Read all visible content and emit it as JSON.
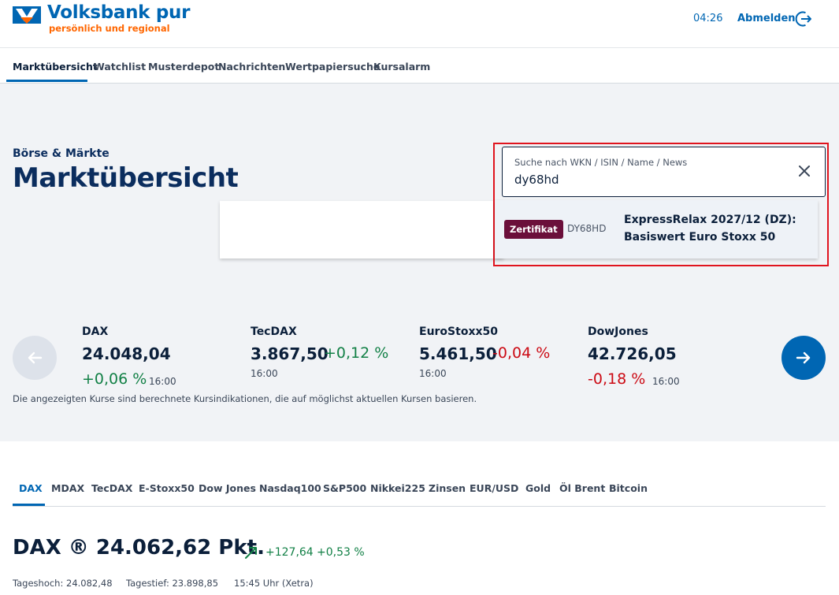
{
  "header": {
    "brand": "Volksbank pur",
    "tagline": "persönlich und regional",
    "session_timer": "04:26",
    "logout_label": "Abmelden"
  },
  "nav": {
    "items": [
      "Marktübersicht",
      "Watchlist",
      "Musterdepot",
      "Nachrichten",
      "Wertpapiersuche",
      "Kursalarm"
    ],
    "active": "Marktübersicht"
  },
  "hero": {
    "kicker": "Börse & Märkte",
    "title": "Marktübersicht"
  },
  "search": {
    "placeholder": "Suche nach WKN / ISIN / Name / News",
    "value": "dy68hd",
    "result": {
      "badge": "Zertifikat",
      "wkn": "DY68HD",
      "name_line1": "ExpressRelax 2027/12 (DZ):",
      "name_line2": "Basiswert Euro Stoxx 50"
    }
  },
  "ticker": [
    {
      "name": "DAX",
      "value": "24.048,04",
      "change": "+0,06 %",
      "time": "16:00",
      "trend": "up"
    },
    {
      "name": "TecDAX",
      "value": "3.867,50",
      "change": "+0,12 %",
      "time": "16:00",
      "trend": "up"
    },
    {
      "name": "EuroStoxx50",
      "value": "5.461,50",
      "change": "-0,04 %",
      "time": "16:00",
      "trend": "down"
    },
    {
      "name": "DowJones",
      "value": "42.726,05",
      "change": "-0,18 %",
      "time": "16:00",
      "trend": "down"
    }
  ],
  "disclaimer": "Die angezeigten Kurse sind berechnete Kursindikationen, die auf möglichst aktuellen Kursen basieren.",
  "index_tabs": [
    "DAX",
    "MDAX",
    "TecDAX",
    "E-Stoxx50",
    "Dow Jones",
    "Nasdaq100",
    "S&P500",
    "Nikkei225",
    "Zinsen",
    "EUR/USD",
    "Gold",
    "Öl Brent",
    "Bitcoin"
  ],
  "quote": {
    "title": "DAX ®  24.062,62 Pkt.",
    "change_abs": "+127,64",
    "change_pct": "+0,53 %",
    "day_high": "Tageshoch: 24.082,48",
    "day_low": "Tagestief: 23.898,85",
    "time": "15:45 Uhr (Xetra)"
  },
  "colors": {
    "brand_blue": "#0066b3",
    "brand_orange": "#ff6600",
    "positive": "#128046",
    "negative": "#cc0a14",
    "badge": "#6b0f3a",
    "highlight": "#e0141e"
  }
}
